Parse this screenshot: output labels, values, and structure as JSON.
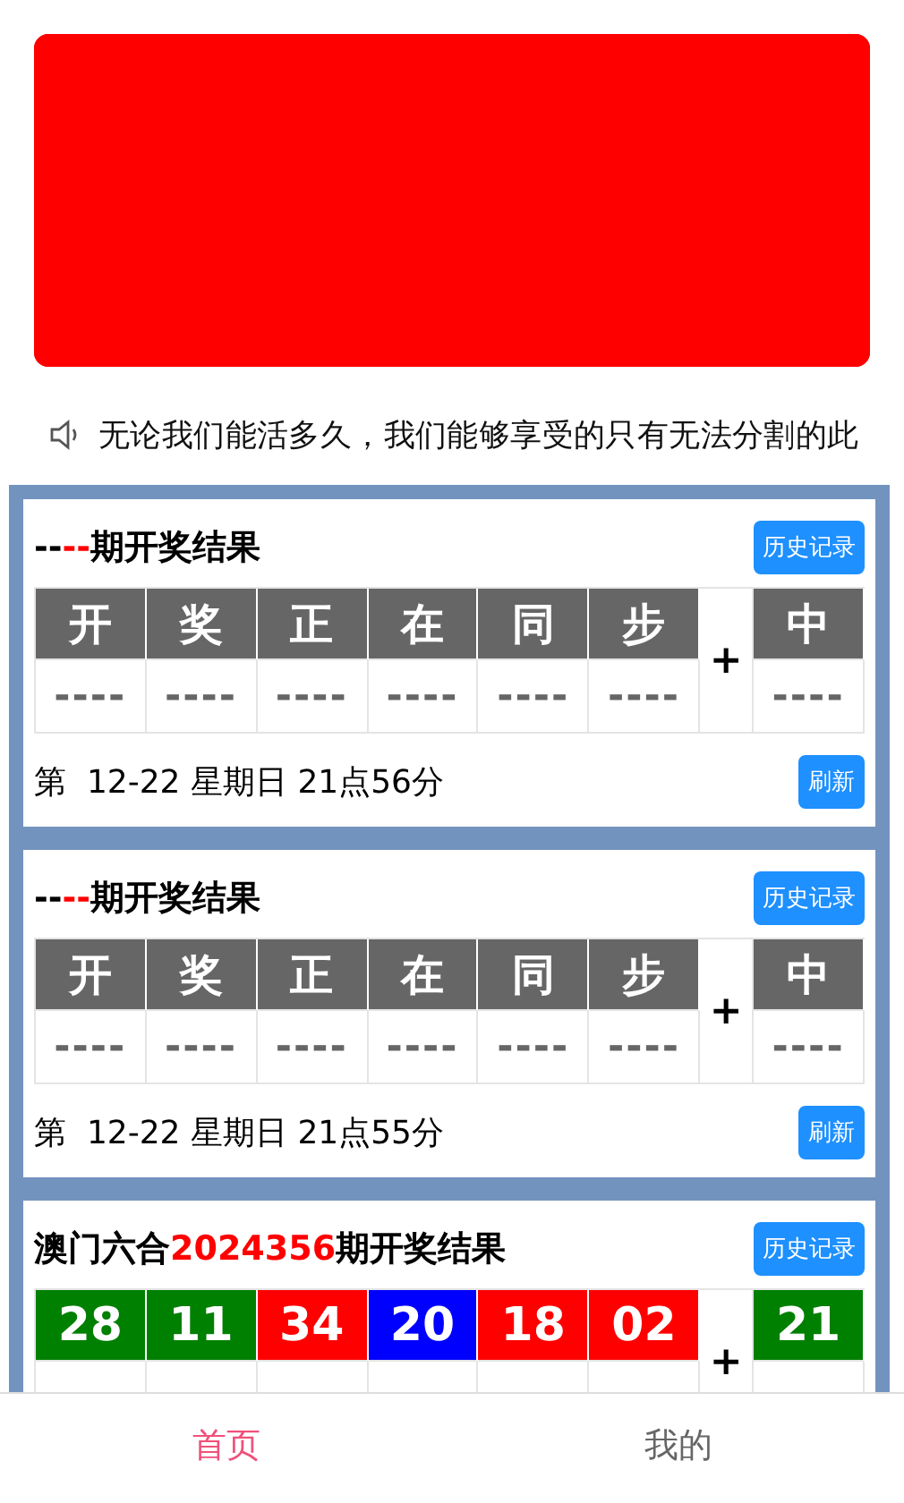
{
  "notice": {
    "text": "无论我们能活多久，我们能够享受的只有无法分割的此"
  },
  "cards": [
    {
      "kind": "pending",
      "title": {
        "prefix": "--",
        "issue": "--",
        "suffix": "期开奖结果"
      },
      "history_button": "历史记录",
      "plus": "+",
      "balls": [
        {
          "label": "开",
          "value": "----"
        },
        {
          "label": "奖",
          "value": "----"
        },
        {
          "label": "正",
          "value": "----"
        },
        {
          "label": "在",
          "value": "----"
        },
        {
          "label": "同",
          "value": "----"
        },
        {
          "label": "步",
          "value": "----"
        }
      ],
      "special": {
        "label": "中",
        "value": "----"
      },
      "next_draw": "第  12-22 星期日 21点56分",
      "refresh_button": "刷新"
    },
    {
      "kind": "pending",
      "title": {
        "prefix": "--",
        "issue": "--",
        "suffix": "期开奖结果"
      },
      "history_button": "历史记录",
      "plus": "+",
      "balls": [
        {
          "label": "开",
          "value": "----"
        },
        {
          "label": "奖",
          "value": "----"
        },
        {
          "label": "正",
          "value": "----"
        },
        {
          "label": "在",
          "value": "----"
        },
        {
          "label": "同",
          "value": "----"
        },
        {
          "label": "步",
          "value": "----"
        }
      ],
      "special": {
        "label": "中",
        "value": "----"
      },
      "next_draw": "第  12-22 星期日 21点55分",
      "refresh_button": "刷新"
    },
    {
      "kind": "drawn",
      "title": {
        "prefix": "澳门六合",
        "issue": "2024356",
        "suffix": "期开奖结果"
      },
      "history_button": "历史记录",
      "plus": "+",
      "balls": [
        {
          "number": "28",
          "color": "#008000"
        },
        {
          "number": "11",
          "color": "#008000"
        },
        {
          "number": "34",
          "color": "#ff0000"
        },
        {
          "number": "20",
          "color": "#0000ff"
        },
        {
          "number": "18",
          "color": "#ff0000"
        },
        {
          "number": "02",
          "color": "#ff0000"
        }
      ],
      "special": {
        "number": "21",
        "color": "#008000"
      }
    }
  ],
  "tabs": [
    {
      "label": "首页",
      "selected": true
    },
    {
      "label": "我的",
      "selected": false
    }
  ]
}
